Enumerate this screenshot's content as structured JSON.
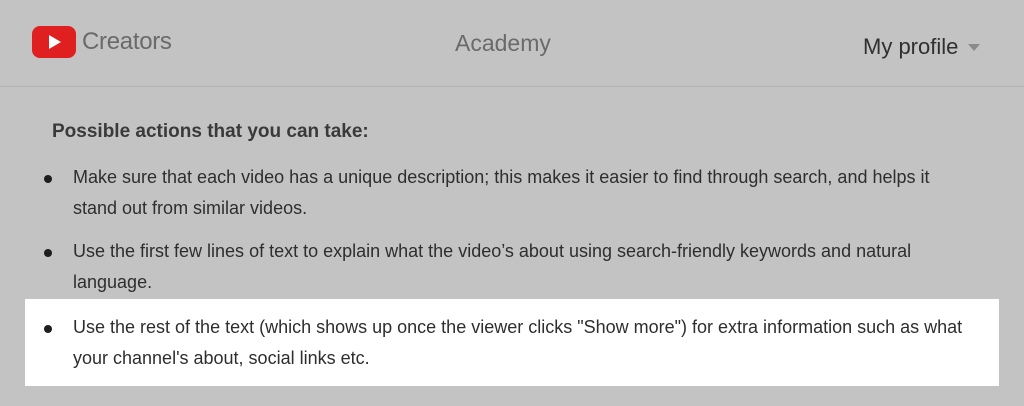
{
  "header": {
    "brand": "Creators",
    "nav_center": "Academy",
    "profile_label": "My profile"
  },
  "main": {
    "heading": "Possible actions that you can take:",
    "items": [
      {
        "text": "Make sure that each video has a unique description; this makes it easier to find through search, and helps it stand out from similar videos."
      },
      {
        "text": "Use the first few lines of text to explain what the video’s about using search-friendly keywords and natural language."
      },
      {
        "text": "Use the rest of the text (which shows up once the viewer clicks \"Show more\") for extra information such as what your channel's about, social links etc."
      }
    ]
  },
  "colors": {
    "background": "#c3c3c3",
    "highlight": "#ffffff",
    "youtube_red": "#e02020"
  },
  "icons": {
    "logo": "youtube-play-icon",
    "profile_menu": "chevron-down-icon",
    "bullet": "bullet-icon"
  }
}
